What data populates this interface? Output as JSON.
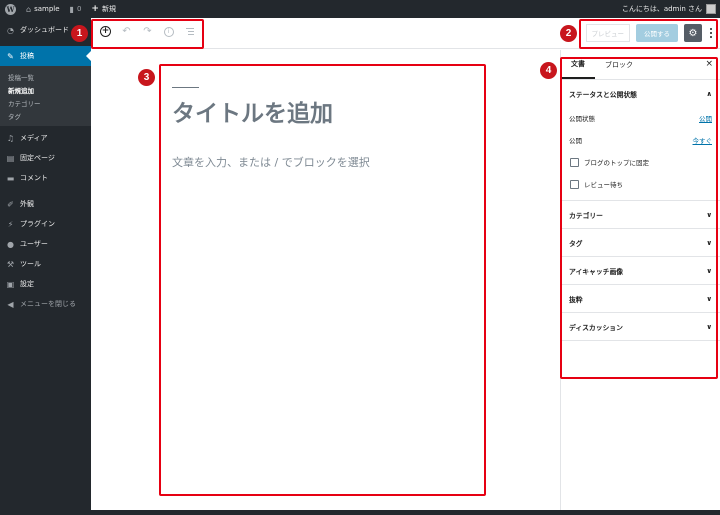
{
  "adminbar": {
    "site_name": "sample",
    "comments_count": "0",
    "new_label": "新規",
    "greeting": "こんにちは、admin さん"
  },
  "sidebar": {
    "dashboard": "ダッシュボード",
    "posts": "投稿",
    "posts_sub": [
      "投稿一覧",
      "新規追加",
      "カテゴリー",
      "タグ"
    ],
    "media": "メディア",
    "pages": "固定ページ",
    "comments": "コメント",
    "appearance": "外観",
    "plugins": "プラグイン",
    "users": "ユーザー",
    "tools": "ツール",
    "settings": "設定",
    "collapse": "メニューを閉じる"
  },
  "header": {
    "preview_label": "プレビュー",
    "publish_label": "公開する"
  },
  "editor": {
    "title_placeholder": "タイトルを追加",
    "body_placeholder": "文章を入力、または / でブロックを選択"
  },
  "panel": {
    "tab_document": "文書",
    "tab_block": "ブロック",
    "close": "×",
    "status_title": "ステータスと公開状態",
    "visibility_label": "公開状態",
    "visibility_value": "公開",
    "publish_label": "公開",
    "publish_value": "今すぐ",
    "sticky_label": "ブログのトップに固定",
    "pending_label": "レビュー待ち",
    "sections": [
      "カテゴリー",
      "タグ",
      "アイキャッチ画像",
      "抜粋",
      "ディスカッション"
    ]
  },
  "callouts": [
    "1",
    "2",
    "3",
    "4"
  ],
  "colors": {
    "admin_dark": "#23282d",
    "accent": "#0073aa",
    "callout_red": "#e60012"
  }
}
